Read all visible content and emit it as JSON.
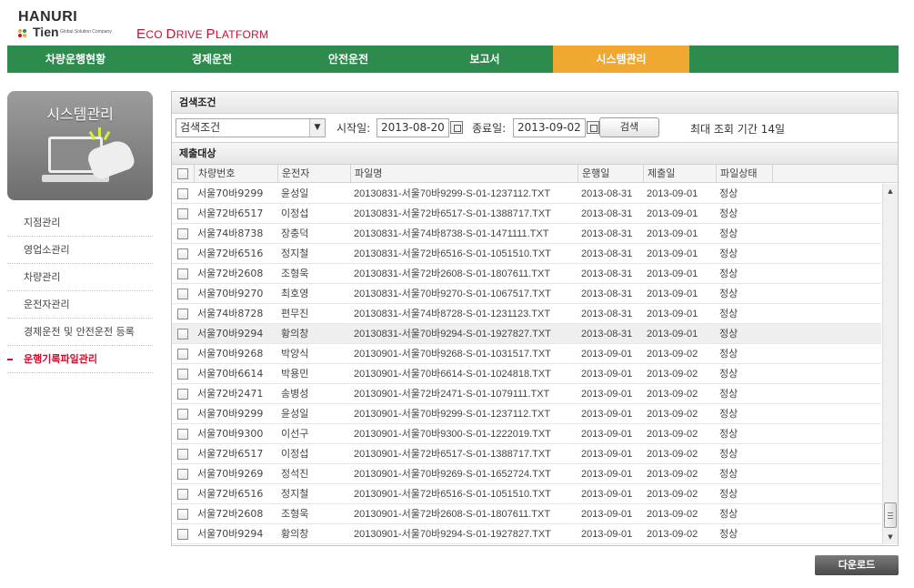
{
  "brand": {
    "name": "HANURI",
    "sub_name": "Tien",
    "tagline": "Global Solution Company",
    "platform_e": "E",
    "platform_co": "CO ",
    "platform_d": "D",
    "platform_rive": "RIVE ",
    "platform_p": "P",
    "platform_latform": "LATFORM",
    "accent_color": "#c8102e"
  },
  "top_nav": {
    "bar_color": "#2e8b4e",
    "active_color": "#f0a830",
    "tabs": [
      {
        "label": "차량운행현황"
      },
      {
        "label": "경제운전"
      },
      {
        "label": "안전운전"
      },
      {
        "label": "보고서"
      },
      {
        "label": "시스템관리",
        "active": true
      }
    ]
  },
  "sidebar": {
    "card_title": "시스템관리",
    "items": [
      {
        "label": "지점관리"
      },
      {
        "label": "영업소관리"
      },
      {
        "label": "차량관리"
      },
      {
        "label": "운전자관리"
      },
      {
        "label": "경제운전 및 안전운전 등록"
      },
      {
        "label": "운행기록파일관리",
        "active": true
      }
    ]
  },
  "search": {
    "section_title": "검색조건",
    "condition_value": "검색조건",
    "start_label": "시작일:",
    "start_date": "2013-08-20",
    "end_label": "종료일:",
    "end_date": "2013-09-02",
    "search_button": "검색",
    "max_period_note": "최대 조회 기간 14일"
  },
  "table": {
    "section_title": "제출대상",
    "headers": {
      "plate": "차량번호",
      "driver": "운전자",
      "filename": "파일명",
      "drive_date": "운행일",
      "submit_date": "제출일",
      "status": "파일상태"
    },
    "rows": [
      {
        "plate": "서울70바9299",
        "driver": "윤성일",
        "filename": "20130831-서울70바9299-S-01-1237112.TXT",
        "drive_date": "2013-08-31",
        "submit_date": "2013-09-01",
        "status": "정상"
      },
      {
        "plate": "서울72바6517",
        "driver": "이정섭",
        "filename": "20130831-서울72바6517-S-01-1388717.TXT",
        "drive_date": "2013-08-31",
        "submit_date": "2013-09-01",
        "status": "정상"
      },
      {
        "plate": "서울74바8738",
        "driver": "장충덕",
        "filename": "20130831-서울74바8738-S-01-1471111.TXT",
        "drive_date": "2013-08-31",
        "submit_date": "2013-09-01",
        "status": "정상"
      },
      {
        "plate": "서울72바6516",
        "driver": "정지철",
        "filename": "20130831-서울72바6516-S-01-1051510.TXT",
        "drive_date": "2013-08-31",
        "submit_date": "2013-09-01",
        "status": "정상"
      },
      {
        "plate": "서울72바2608",
        "driver": "조형욱",
        "filename": "20130831-서울72바2608-S-01-1807611.TXT",
        "drive_date": "2013-08-31",
        "submit_date": "2013-09-01",
        "status": "정상"
      },
      {
        "plate": "서울70바9270",
        "driver": "최호영",
        "filename": "20130831-서울70바9270-S-01-1067517.TXT",
        "drive_date": "2013-08-31",
        "submit_date": "2013-09-01",
        "status": "정상"
      },
      {
        "plate": "서울74바8728",
        "driver": "편무진",
        "filename": "20130831-서울74바8728-S-01-1231123.TXT",
        "drive_date": "2013-08-31",
        "submit_date": "2013-09-01",
        "status": "정상"
      },
      {
        "plate": "서울70바9294",
        "driver": "황의창",
        "filename": "20130831-서울70바9294-S-01-1927827.TXT",
        "drive_date": "2013-08-31",
        "submit_date": "2013-09-01",
        "status": "정상",
        "highlight": true
      },
      {
        "plate": "서울70바9268",
        "driver": "박양식",
        "filename": "20130901-서울70바9268-S-01-1031517.TXT",
        "drive_date": "2013-09-01",
        "submit_date": "2013-09-02",
        "status": "정상"
      },
      {
        "plate": "서울70바6614",
        "driver": "박용민",
        "filename": "20130901-서울70바6614-S-01-1024818.TXT",
        "drive_date": "2013-09-01",
        "submit_date": "2013-09-02",
        "status": "정상"
      },
      {
        "plate": "서울72바2471",
        "driver": "송병성",
        "filename": "20130901-서울72바2471-S-01-1079111.TXT",
        "drive_date": "2013-09-01",
        "submit_date": "2013-09-02",
        "status": "정상"
      },
      {
        "plate": "서울70바9299",
        "driver": "윤성일",
        "filename": "20130901-서울70바9299-S-01-1237112.TXT",
        "drive_date": "2013-09-01",
        "submit_date": "2013-09-02",
        "status": "정상"
      },
      {
        "plate": "서울70바9300",
        "driver": "이선구",
        "filename": "20130901-서울70바9300-S-01-1222019.TXT",
        "drive_date": "2013-09-01",
        "submit_date": "2013-09-02",
        "status": "정상"
      },
      {
        "plate": "서울72바6517",
        "driver": "이정섭",
        "filename": "20130901-서울72바6517-S-01-1388717.TXT",
        "drive_date": "2013-09-01",
        "submit_date": "2013-09-02",
        "status": "정상"
      },
      {
        "plate": "서울70바9269",
        "driver": "정석진",
        "filename": "20130901-서울70바9269-S-01-1652724.TXT",
        "drive_date": "2013-09-01",
        "submit_date": "2013-09-02",
        "status": "정상"
      },
      {
        "plate": "서울72바6516",
        "driver": "정지철",
        "filename": "20130901-서울72바6516-S-01-1051510.TXT",
        "drive_date": "2013-09-01",
        "submit_date": "2013-09-02",
        "status": "정상"
      },
      {
        "plate": "서울72바2608",
        "driver": "조형욱",
        "filename": "20130901-서울72바2608-S-01-1807611.TXT",
        "drive_date": "2013-09-01",
        "submit_date": "2013-09-02",
        "status": "정상"
      },
      {
        "plate": "서울70바9294",
        "driver": "황의창",
        "filename": "20130901-서울70바9294-S-01-1927827.TXT",
        "drive_date": "2013-09-01",
        "submit_date": "2013-09-02",
        "status": "정상"
      }
    ]
  },
  "download_button": "다운로드"
}
